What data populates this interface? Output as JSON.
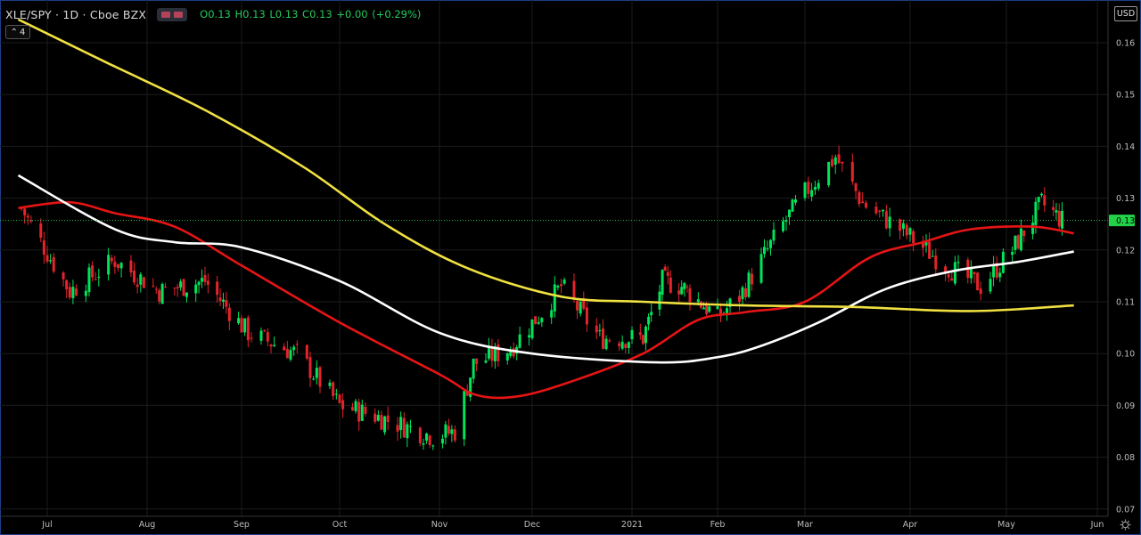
{
  "header": {
    "symbol": "XLE/SPY · 1D · Cboe BZX",
    "ohlc": "O0.13 H0.13 L0.13 C0.13 +0.00 (+0.29%)"
  },
  "study_count": "4",
  "currency_label": "USD",
  "last_price_label": "0.13",
  "colors": {
    "background": "#000000",
    "up": "#00e35a",
    "down": "#e3242b",
    "ma_yellow": "#f0e040",
    "ma_white": "#ffffff",
    "ma_red": "#e61414",
    "grid": "#1c1c1c",
    "price_line": "#2fbf4a",
    "frame": "#1c3f86"
  },
  "chart_data": {
    "type": "candlestick",
    "title": "XLE/SPY · 1D · Cboe BZX",
    "x_tick_labels": [
      "Jul",
      "Aug",
      "Sep",
      "Oct",
      "Nov",
      "Dec",
      "2021",
      "Feb",
      "Mar",
      "Apr",
      "May",
      "Jun"
    ],
    "y_tick_labels": [
      "0.16",
      "0.15",
      "0.14",
      "0.13",
      "0.12",
      "0.11",
      "0.10",
      "0.09",
      "0.08",
      "0.07"
    ],
    "ylim": [
      0.07,
      0.1645
    ],
    "grid": true,
    "last_price": 0.1257,
    "price_anchors": [
      [
        "2020-06-23",
        0.128
      ],
      [
        "2020-07-08",
        0.112
      ],
      [
        "2020-07-22",
        0.118
      ],
      [
        "2020-08-05",
        0.112
      ],
      [
        "2020-08-20",
        0.114
      ],
      [
        "2020-09-03",
        0.104
      ],
      [
        "2020-09-18",
        0.1
      ],
      [
        "2020-10-01",
        0.09
      ],
      [
        "2020-10-12",
        0.088
      ],
      [
        "2020-10-30",
        0.084
      ],
      [
        "2020-11-06",
        0.085
      ],
      [
        "2020-11-12",
        0.098
      ],
      [
        "2020-11-24",
        0.101
      ],
      [
        "2020-12-04",
        0.108
      ],
      [
        "2020-12-10",
        0.113
      ],
      [
        "2020-12-22",
        0.103
      ],
      [
        "2021-01-05",
        0.103
      ],
      [
        "2021-01-12",
        0.114
      ],
      [
        "2021-01-19",
        0.113
      ],
      [
        "2021-02-01",
        0.107
      ],
      [
        "2021-02-08",
        0.111
      ],
      [
        "2021-02-15",
        0.118
      ],
      [
        "2021-02-22",
        0.125
      ],
      [
        "2021-03-01",
        0.131
      ],
      [
        "2021-03-10",
        0.138
      ],
      [
        "2021-03-18",
        0.129
      ],
      [
        "2021-03-29",
        0.124
      ],
      [
        "2021-04-12",
        0.117
      ],
      [
        "2021-04-23",
        0.113
      ],
      [
        "2021-05-03",
        0.12
      ],
      [
        "2021-05-13",
        0.129
      ],
      [
        "2021-05-20",
        0.1257
      ]
    ],
    "series": [
      {
        "name": "",
        "color": "#e61414",
        "points": [
          [
            "2020-06-22",
            0.1281
          ],
          [
            "2020-07-08",
            0.1292
          ],
          [
            "2020-07-22",
            0.1271
          ],
          [
            "2020-08-10",
            0.1245
          ],
          [
            "2020-09-01",
            0.117
          ],
          [
            "2020-10-01",
            0.106
          ],
          [
            "2020-11-01",
            0.096
          ],
          [
            "2020-11-13",
            0.092
          ],
          [
            "2020-11-27",
            0.0918
          ],
          [
            "2020-12-15",
            0.095
          ],
          [
            "2021-01-05",
            0.1
          ],
          [
            "2021-01-25",
            0.1065
          ],
          [
            "2021-02-10",
            0.108
          ],
          [
            "2021-03-01",
            0.11
          ],
          [
            "2021-03-20",
            0.1185
          ],
          [
            "2021-04-05",
            0.1215
          ],
          [
            "2021-04-20",
            0.124
          ],
          [
            "2021-05-10",
            0.1245
          ],
          [
            "2021-05-24",
            0.1232
          ]
        ]
      },
      {
        "name": "",
        "color": "#ffffff",
        "points": [
          [
            "2020-06-22",
            0.1344
          ],
          [
            "2020-07-22",
            0.124
          ],
          [
            "2020-08-10",
            0.1215
          ],
          [
            "2020-09-01",
            0.1205
          ],
          [
            "2020-10-01",
            0.114
          ],
          [
            "2020-11-01",
            0.104
          ],
          [
            "2020-12-01",
            0.1
          ],
          [
            "2021-01-10",
            0.0983
          ],
          [
            "2021-02-01",
            0.0993
          ],
          [
            "2021-02-15",
            0.1015
          ],
          [
            "2021-03-05",
            0.106
          ],
          [
            "2021-03-25",
            0.1125
          ],
          [
            "2021-04-15",
            0.116
          ],
          [
            "2021-05-05",
            0.1177
          ],
          [
            "2021-05-24",
            0.1197
          ]
        ]
      },
      {
        "name": "",
        "color": "#f0e040",
        "points": [
          [
            "2020-06-22",
            0.1645
          ],
          [
            "2020-07-20",
            0.156
          ],
          [
            "2020-08-20",
            0.147
          ],
          [
            "2020-09-20",
            0.136
          ],
          [
            "2020-10-15",
            0.125
          ],
          [
            "2020-11-10",
            0.1165
          ],
          [
            "2020-12-10",
            0.111
          ],
          [
            "2021-01-05",
            0.11
          ],
          [
            "2021-02-10",
            0.1093
          ],
          [
            "2021-03-15",
            0.109
          ],
          [
            "2021-04-20",
            0.1082
          ],
          [
            "2021-05-24",
            0.1093
          ]
        ]
      }
    ]
  }
}
